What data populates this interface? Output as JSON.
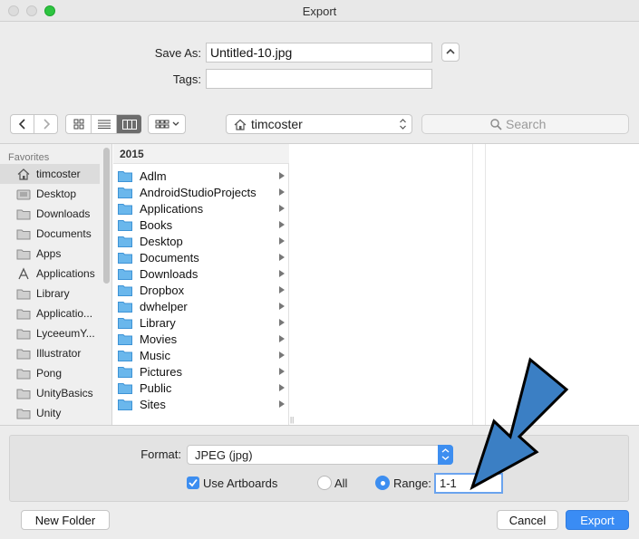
{
  "window": {
    "title": "Export"
  },
  "save": {
    "save_as_label": "Save As:",
    "filename": "Untitled-10.jpg",
    "tags_label": "Tags:",
    "tags_value": ""
  },
  "toolbar": {
    "location": "timcoster",
    "search_placeholder": "Search"
  },
  "sidebar": {
    "heading": "Favorites",
    "items": [
      {
        "label": "timcoster",
        "icon": "home-icon",
        "selected": true
      },
      {
        "label": "Desktop",
        "icon": "desktop-folder-icon"
      },
      {
        "label": "Downloads",
        "icon": "folder-icon"
      },
      {
        "label": "Documents",
        "icon": "folder-icon"
      },
      {
        "label": "Apps",
        "icon": "folder-icon"
      },
      {
        "label": "Applications",
        "icon": "applications-icon"
      },
      {
        "label": "Library",
        "icon": "folder-icon"
      },
      {
        "label": "Applicatio...",
        "icon": "folder-icon"
      },
      {
        "label": "LyceeumY...",
        "icon": "folder-icon"
      },
      {
        "label": "Illustrator",
        "icon": "folder-icon"
      },
      {
        "label": "Pong",
        "icon": "folder-icon"
      },
      {
        "label": "UnityBasics",
        "icon": "folder-icon"
      },
      {
        "label": "Unity",
        "icon": "folder-icon"
      }
    ]
  },
  "column1": {
    "header": "2015",
    "items": [
      {
        "label": "Adlm"
      },
      {
        "label": "AndroidStudioProjects"
      },
      {
        "label": "Applications"
      },
      {
        "label": "Books"
      },
      {
        "label": "Desktop"
      },
      {
        "label": "Documents"
      },
      {
        "label": "Downloads"
      },
      {
        "label": "Dropbox"
      },
      {
        "label": "dwhelper"
      },
      {
        "label": "Library"
      },
      {
        "label": "Movies"
      },
      {
        "label": "Music"
      },
      {
        "label": "Pictures"
      },
      {
        "label": "Public"
      },
      {
        "label": "Sites"
      }
    ]
  },
  "options": {
    "format_label": "Format:",
    "format_value": "JPEG (jpg)",
    "use_artboards_label": "Use Artboards",
    "all_label": "All",
    "range_label": "Range:",
    "range_value": "1-1"
  },
  "buttons": {
    "new_folder": "New Folder",
    "cancel": "Cancel",
    "export": "Export"
  },
  "colors": {
    "accent": "#3a8cf4",
    "annotation_arrow": "#3b7fc4",
    "zoom_button": "#2dc440"
  }
}
